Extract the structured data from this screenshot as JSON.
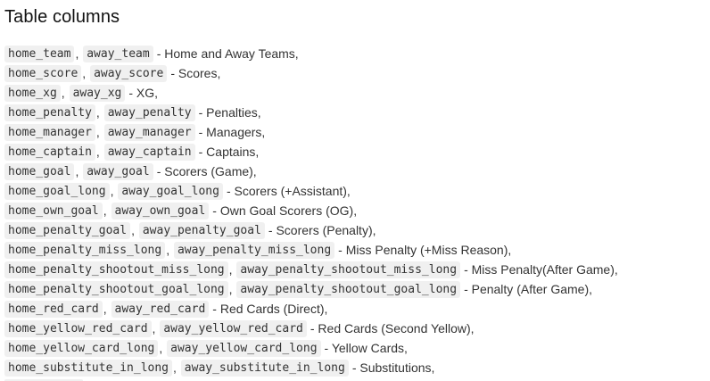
{
  "heading": "Table columns",
  "rows": [
    {
      "home": "home_team",
      "sep": ",",
      "away": "away_team",
      "desc": "- Home and Away Teams,"
    },
    {
      "home": "home_score",
      "sep": ",",
      "away": "away_score",
      "desc": "- Scores,"
    },
    {
      "home": "home_xg",
      "sep": ",",
      "away": "away_xg",
      "desc": "- XG,"
    },
    {
      "home": "home_penalty",
      "sep": ",",
      "away": "away_penalty",
      "desc": "- Penalties,"
    },
    {
      "home": "home_manager",
      "sep": ",",
      "away": "away_manager",
      "desc": "- Managers,"
    },
    {
      "home": "home_captain",
      "sep": ",",
      "away": "away_captain",
      "desc": "- Captains,"
    },
    {
      "home": "home_goal",
      "sep": ",",
      "away": "away_goal",
      "desc": "- Scorers (Game),"
    },
    {
      "home": "home_goal_long",
      "sep": ",",
      "away": "away_goal_long",
      "desc": "- Scorers (+Assistant),"
    },
    {
      "home": "home_own_goal",
      "sep": ",",
      "away": "away_own_goal",
      "desc": "- Own Goal Scorers (OG),"
    },
    {
      "home": "home_penalty_goal",
      "sep": ",",
      "away": "away_penalty_goal",
      "desc": "- Scorers (Penalty),"
    },
    {
      "home": "home_penalty_miss_long",
      "sep": ",",
      "away": "away_penalty_miss_long",
      "desc": "- Miss Penalty (+Miss Reason),"
    },
    {
      "home": "home_penalty_shootout_miss_long",
      "sep": ",",
      "away": "away_penalty_shootout_miss_long",
      "desc": "- Miss Penalty(After Game),"
    },
    {
      "home": "home_penalty_shootout_goal_long",
      "sep": ",",
      "away": "away_penalty_shootout_goal_long",
      "desc": "- Penalty (After Game),"
    },
    {
      "home": "home_red_card",
      "sep": ",",
      "away": "away_red_card",
      "desc": "- Red Cards (Direct),"
    },
    {
      "home": "home_yellow_red_card",
      "sep": ",",
      "away": "away_yellow_red_card",
      "desc": "- Red Cards (Second Yellow),"
    },
    {
      "home": "home_yellow_card_long",
      "sep": ",",
      "away": "away_yellow_card_long",
      "desc": "- Yellow Cards,"
    },
    {
      "home": "home_substitute_in_long",
      "sep": ",",
      "away": "away_substitute_in_long",
      "desc": "- Substitutions,"
    }
  ]
}
